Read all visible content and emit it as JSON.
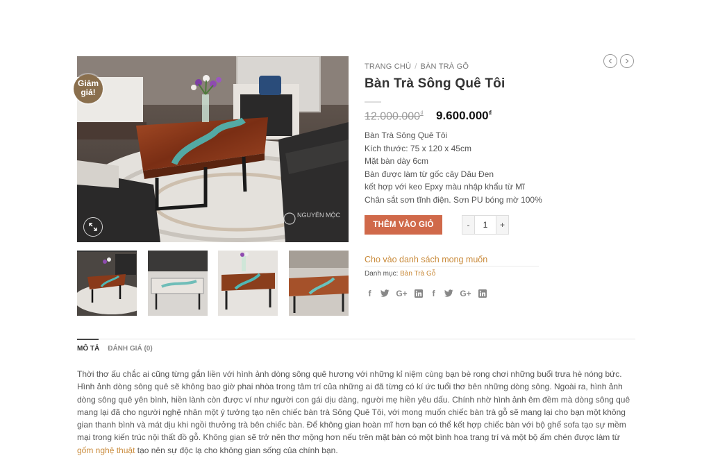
{
  "badge": {
    "line1": "Giảm",
    "line2": "giá!"
  },
  "breadcrumb": {
    "home": "TRANG CHỦ",
    "separator": "/",
    "category": "BÀN TRÀ GỖ"
  },
  "product": {
    "title": "Bàn Trà Sông Quê Tôi",
    "price_old": "12.000.000",
    "price_new": "9.600.000",
    "currency": "₫",
    "description": [
      "Bàn Trà Sông Quê Tôi",
      "Kích thước: 75 x 120 x 45cm",
      "Mặt bàn dày 6cm",
      "Bàn được làm từ gốc cây Dâu Đen",
      "kết hợp với keo Epxy màu nhập khẩu từ Mĩ",
      "Chân sắt sơn tĩnh điện. Sơn PU bóng mờ 100%"
    ]
  },
  "cart": {
    "button_label": "THÊM VÀO GIỎ",
    "minus": "-",
    "plus": "+",
    "quantity": "1"
  },
  "wishlist_label": "Cho vào danh sách mong muốn",
  "category": {
    "label": "Danh mục:",
    "value": "Bàn Trà Gỗ"
  },
  "share_icons": [
    "facebook-icon",
    "twitter-icon",
    "google-plus-icon",
    "linkedin-icon",
    "facebook-icon",
    "twitter-icon",
    "google-plus-icon",
    "linkedin-icon"
  ],
  "tabs": [
    {
      "label": "MÔ TẢ",
      "active": true
    },
    {
      "label": "ĐÁNH GIÁ (0)",
      "active": false
    }
  ],
  "description_text": {
    "before_link": "Thời thơ ấu chắc ai cũng từng gắn liền với hình ảnh dòng sông quê hương với những kỉ niệm cùng bạn bè rong chơi những buổi trưa hè nóng bức. Hình ảnh dòng sông quê sẽ không bao giờ phai nhòa trong tâm trí của những ai đã từng có kí ức tuổi thơ bên những dòng sông. Ngoài ra, hình ảnh dòng sông quê yên bình, hiền lành còn được ví như người con gái dịu dàng, người mẹ hiền yêu dấu. Chính nhờ hình ảnh êm đềm mà dòng sông quê mang lại đã cho người nghệ nhân một ý tưởng tạo nên chiếc bàn trà Sông Quê Tôi, với mong muốn chiếc bàn trà gỗ sẽ mang lại cho bạn một không gian thanh bình và mát dịu khi ngồi thưởng trà bên chiếc bàn. Để không gian hoàn mĩ hơn bạn có thể kết hợp chiếc bàn với bộ ghế sofa tạo sự mềm mại trong kiến trúc nội thất đồ gỗ. Không gian sẽ trở nên thơ mộng hơn nếu trên mặt bàn có một bình hoa trang trí và một bộ ấm chén được làm từ ",
    "link": "gốm nghệ thuật",
    "after_link": " tạo nên sự độc lạ cho không gian sống của chính bạn."
  },
  "watermark": "NGUYÊN MỘC",
  "colors": {
    "accent": "#d0694a",
    "link": "#c98a3a",
    "badge": "#8a6f4d"
  }
}
